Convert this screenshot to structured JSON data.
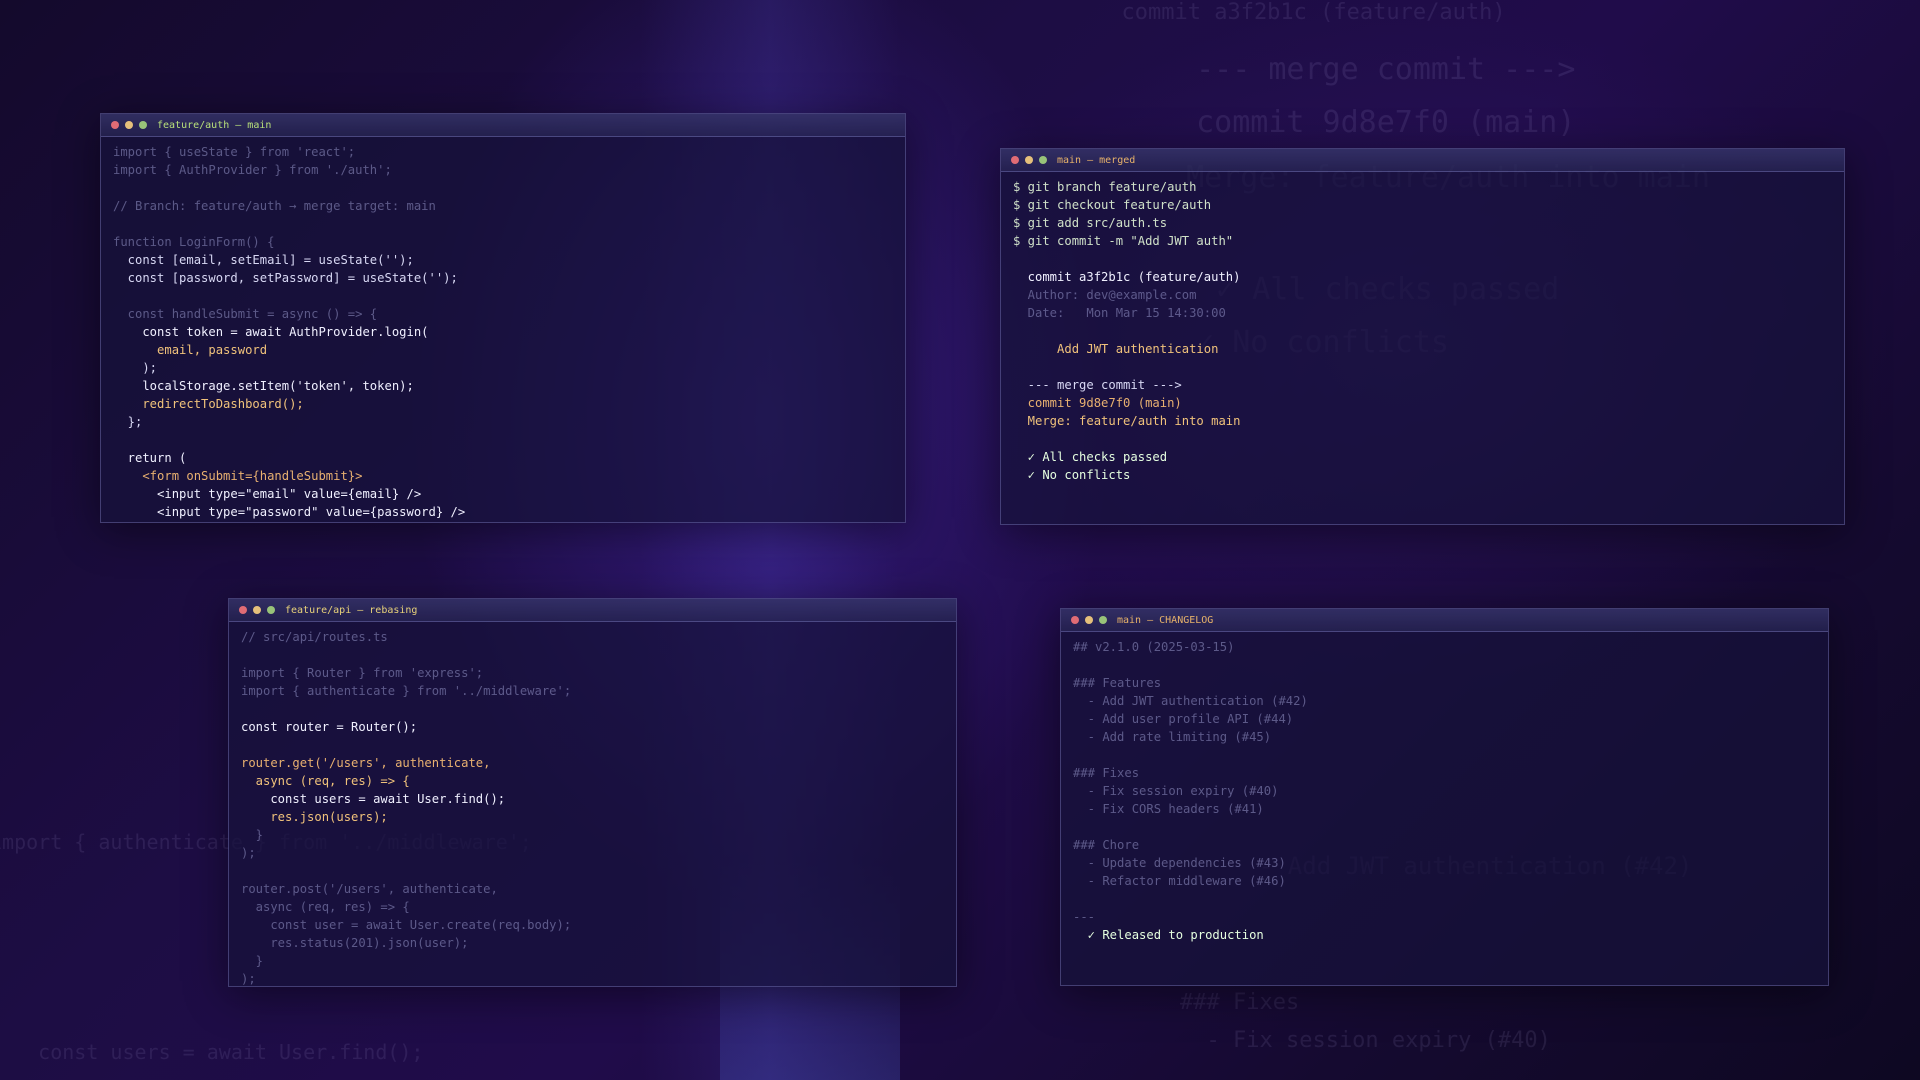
{
  "colors": {
    "dot_red": "#e06c75",
    "dot_yellow": "#e5c07b",
    "dot_green": "#98c379"
  },
  "window_icons": [
    "close-dot",
    "minimize-dot",
    "maximize-dot"
  ],
  "windows": {
    "auth": {
      "title": "feature/auth — main",
      "lines": [
        "import { useState } from 'react';",
        "import { AuthProvider } from './auth';",
        "",
        "// Branch: feature/auth → merge target: main",
        "",
        "function LoginForm() {",
        "  const [email, setEmail] = useState('');",
        "  const [password, setPassword] = useState('');",
        "",
        "  const handleSubmit = async () => {",
        "    const token = await AuthProvider.login(",
        "      email, password",
        "    );",
        "    localStorage.setItem('token', token);",
        "    redirectToDashboard();",
        "  };",
        "",
        "  return (",
        "    <form onSubmit={handleSubmit}>",
        "      <input type=\"email\" value={email} />",
        "      <input type=\"password\" value={password} />"
      ]
    },
    "merged": {
      "title": "main — merged",
      "lines": [
        "$ git branch feature/auth",
        "$ git checkout feature/auth",
        "$ git add src/auth.ts",
        "$ git commit -m \"Add JWT auth\"",
        "",
        "  commit a3f2b1c (feature/auth)",
        "  Author: dev@example.com",
        "  Date:   Mon Mar 15 14:30:00",
        "",
        "      Add JWT authentication",
        "",
        "  --- merge commit --->",
        "  commit 9d8e7f0 (main)",
        "  Merge: feature/auth into main",
        "",
        "  ✓ All checks passed",
        "  ✓ No conflicts"
      ]
    },
    "api": {
      "title": "feature/api — rebasing",
      "lines": [
        "// src/api/routes.ts",
        "",
        "import { Router } from 'express';",
        "import { authenticate } from '../middleware';",
        "",
        "const router = Router();",
        "",
        "router.get('/users', authenticate,",
        "  async (req, res) => {",
        "    const users = await User.find();",
        "    res.json(users);",
        "  }",
        ");",
        "",
        "router.post('/users', authenticate,",
        "  async (req, res) => {",
        "    const user = await User.create(req.body);",
        "    res.status(201).json(user);",
        "  }",
        ");"
      ]
    },
    "changelog": {
      "title": "main — CHANGELOG",
      "lines": [
        "## v2.1.0 (2025-03-15)",
        "",
        "### Features",
        "  - Add JWT authentication (#42)",
        "  - Add user profile API (#44)",
        "  - Add rate limiting (#45)",
        "",
        "### Fixes",
        "  - Fix session expiry (#40)",
        "  - Fix CORS headers (#41)",
        "",
        "### Chore",
        "  - Update dependencies (#43)",
        "  - Refactor middleware (#46)",
        "",
        "---",
        "  ✓ Released to production"
      ]
    }
  }
}
